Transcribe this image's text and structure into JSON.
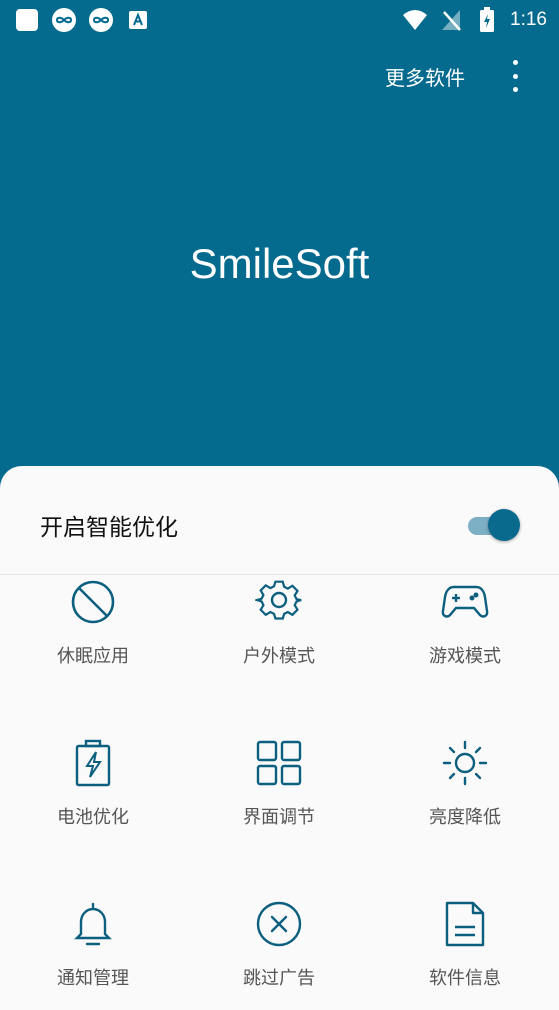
{
  "status_bar": {
    "time": "1:16",
    "left_icons": [
      "square-app-icon",
      "loop-app-icon",
      "loop-app-icon",
      "font-app-icon"
    ],
    "right_icons": [
      "wifi-icon",
      "no-signal-icon",
      "battery-charging-icon"
    ]
  },
  "toolbar": {
    "more_apps_label": "更多软件",
    "overflow_icon": "more-vertical-icon"
  },
  "hero": {
    "title": "SmileSoft",
    "background": "#056b8e"
  },
  "sheet": {
    "toggle_label": "开启智能优化",
    "toggle_on": true,
    "accent": "#0a6a8d"
  },
  "grid": [
    {
      "label": "休眠应用",
      "icon": "block-icon"
    },
    {
      "label": "户外模式",
      "icon": "gear-icon"
    },
    {
      "label": "游戏模式",
      "icon": "gamepad-icon"
    },
    {
      "label": "电池优化",
      "icon": "battery-icon"
    },
    {
      "label": "界面调节",
      "icon": "grid-icon"
    },
    {
      "label": "亮度降低",
      "icon": "brightness-icon"
    },
    {
      "label": "通知管理",
      "icon": "bell-icon"
    },
    {
      "label": "跳过广告",
      "icon": "close-circle-icon"
    },
    {
      "label": "软件信息",
      "icon": "document-icon"
    }
  ]
}
